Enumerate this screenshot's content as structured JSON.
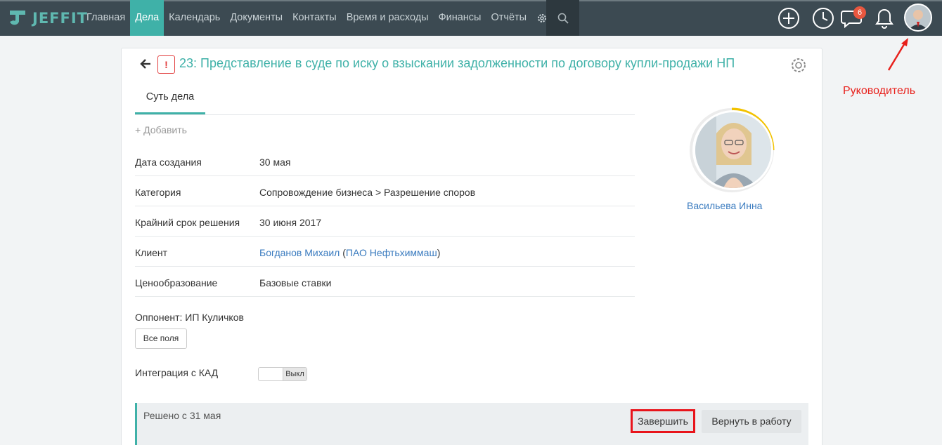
{
  "brand": {
    "name": "JEFFIT",
    "accent": "#3fb1a8"
  },
  "nav": {
    "items": [
      "Главная",
      "Дела",
      "Календарь",
      "Документы",
      "Контакты",
      "Время и расходы",
      "Финансы",
      "Отчёты"
    ],
    "active": "Дела",
    "icons": [
      "gear-icon",
      "search-icon"
    ]
  },
  "toolbar": {
    "icons": [
      "add-circle-icon",
      "clock-icon",
      "chat-icon",
      "bell-icon"
    ],
    "chat_badge": "6"
  },
  "annotation": {
    "label": "Руководитель",
    "color": "#e8201b"
  },
  "case": {
    "title": "23: Представление в суде по иску о взыскании задолженности по договору купли-продажи НП",
    "priority_mark": "!",
    "tab": "Суть дела",
    "add": "+ Добавить",
    "fields": [
      {
        "label": "Дата создания",
        "value": "30 мая"
      },
      {
        "label": "Категория",
        "value": "Сопровождение бизнеса > Разрешение споров"
      },
      {
        "label": "Крайний срок решения",
        "value": "30 июня 2017"
      },
      {
        "label": "Клиент",
        "value_name": "Богданов Михаил",
        "value_open": " (",
        "value_company": "ПАО Нефтьхиммаш",
        "value_close": ")"
      },
      {
        "label": "Ценообразование",
        "value": "Базовые ставки"
      }
    ],
    "opponent": "Оппонент: ИП Куличков",
    "all_fields_button": "Все поля",
    "kad_label": "Интеграция с КАД",
    "kad_toggle": "Выкл",
    "status": "Решено с 31 мая",
    "finish_button": "Завершить",
    "return_button": "Вернуть в работу",
    "assignee": "Васильева Инна"
  }
}
